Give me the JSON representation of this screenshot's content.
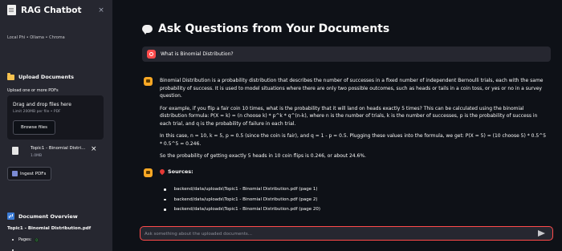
{
  "sidebar": {
    "title": "RAG Chatbot",
    "subtitle": "Local Phi • Ollama • Chroma",
    "close_symbol": "×",
    "upload_section": "Upload Documents",
    "upload_label": "Upload one or more PDFs",
    "dropzone_title": "Drag and drop files here",
    "dropzone_limit": "Limit 200MB per file • PDF",
    "browse_button": "Browse files",
    "file": {
      "name": "Topic1 - Binomial Distri...",
      "size": "1.0MB",
      "remove_symbol": "×"
    },
    "ingest_button": "Ingest PDFs",
    "overview_section": "Document Overview",
    "overview_file": "Topic1 - Binomial Distribution.pdf",
    "pages_label": "Pages:",
    "pages_value": "0"
  },
  "main": {
    "title": "Ask Questions from Your Documents",
    "user_question": "What is Binomial Distribution?",
    "answer_paragraphs": [
      "Binomial Distribution is a probability distribution that describes the number of successes in a fixed number of independent Bernoulli trials, each with the same probability of success. It is used to model situations where there are only two possible outcomes, such as heads or tails in a coin toss, or yes or no in a survey question.",
      "For example, if you flip a fair coin 10 times, what is the probability that it will land on heads exactly 5 times? This can be calculated using the binomial distribution formula: P(X = k) = (n choose k) * p^k * q^(n-k), where n is the number of trials, k is the number of successes, p is the probability of success in each trial, and q is the probability of failure in each trial.",
      "In this case, n = 10, k = 5, p = 0.5 (since the coin is fair), and q = 1 - p = 0.5. Plugging these values into the formula, we get: P(X = 5) = (10 choose 5) * 0.5^5 * 0.5^5 = 0.246.",
      "So the probability of getting exactly 5 heads in 10 coin flips is 0.246, or about 24.6%."
    ],
    "sources_heading": "Sources:",
    "sources": [
      "backend/data/uploads\\Topic1 - Binomial Distribution.pdf (page 1)",
      "backend/data/uploads\\Topic1 - Binomial Distribution.pdf (page 2)",
      "backend/data/uploads\\Topic1 - Binomial Distribution.pdf (page 20)"
    ],
    "input_placeholder": "Ask something about the uploaded documents..."
  },
  "colors": {
    "sidebar_bg": "#262730",
    "main_bg": "#0e1117",
    "accent": "#ff4b4b",
    "bot_avatar": "#f9a825"
  }
}
